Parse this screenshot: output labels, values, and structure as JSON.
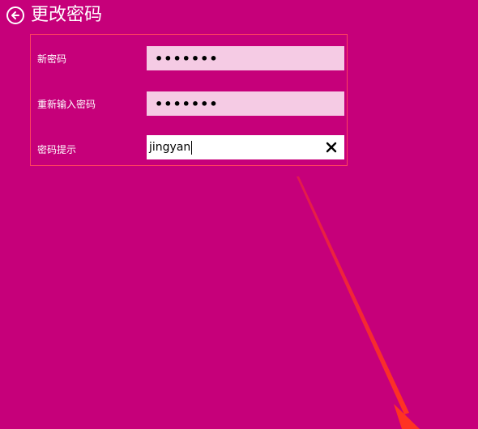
{
  "header": {
    "title": "更改密码",
    "back_icon": "back-arrow-circle-icon"
  },
  "form": {
    "new_password": {
      "label": "新密码",
      "masked_value": "•••••••"
    },
    "confirm_password": {
      "label": "重新输入密码",
      "masked_value": "•••••••"
    },
    "password_hint": {
      "label": "密码提示",
      "value": "jingyan",
      "clear_icon": "clear-x-icon"
    }
  },
  "colors": {
    "background": "#c6007a",
    "frame_border": "#ff4060",
    "input_fill": "#f5cbe4",
    "focused_input_fill": "#ffffff",
    "annotation_arrow": "#ff3322"
  }
}
